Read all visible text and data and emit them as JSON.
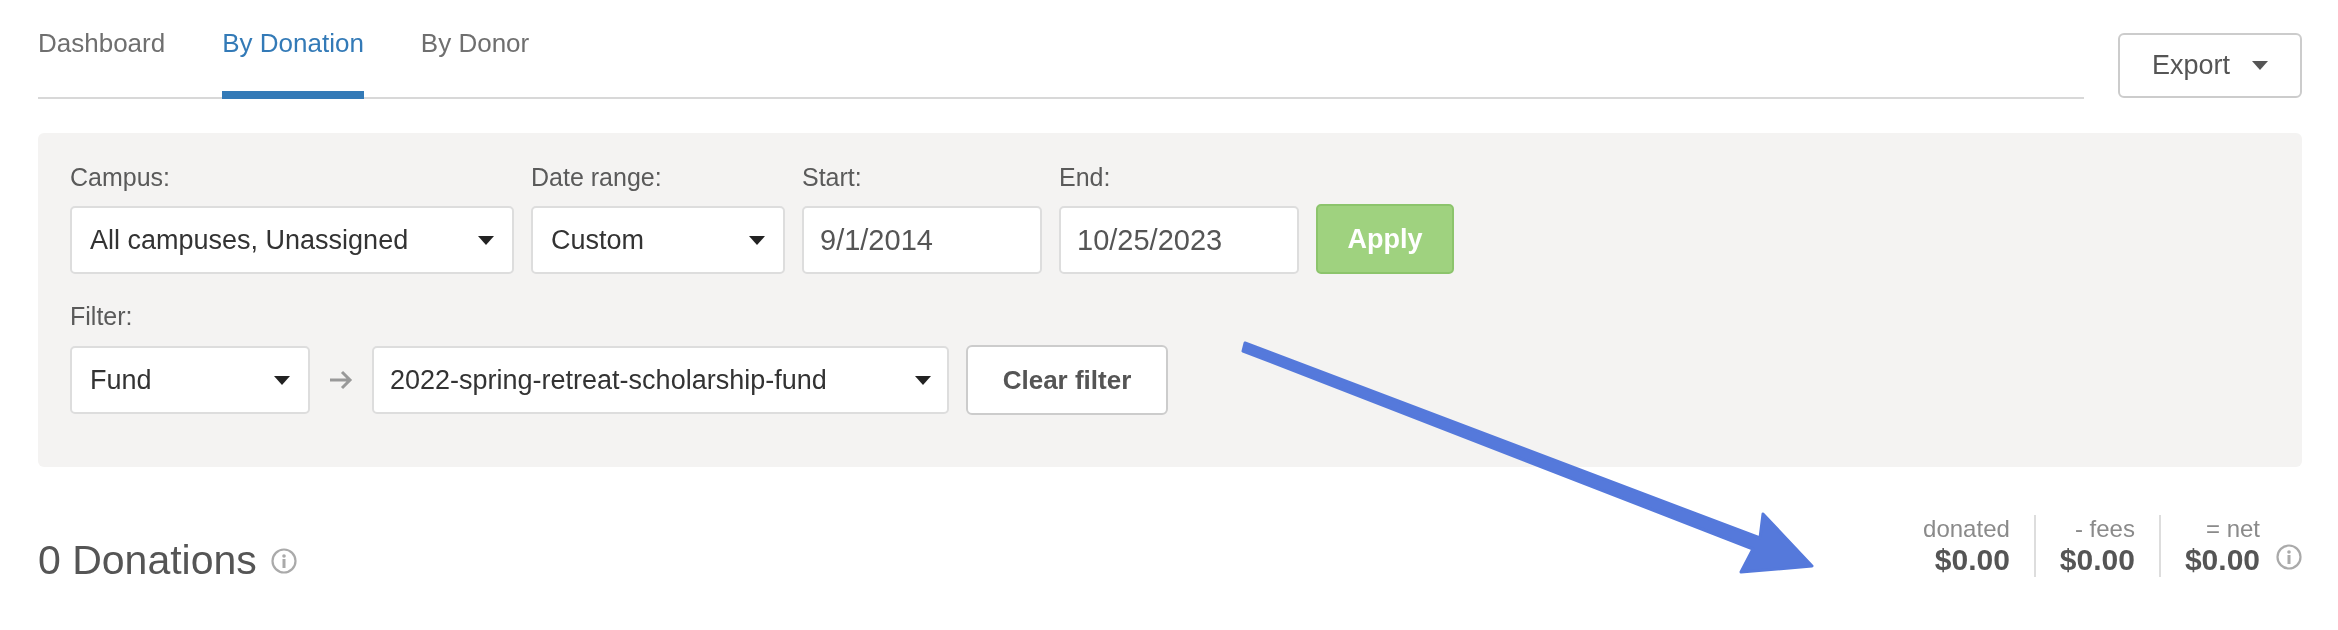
{
  "tabs": [
    {
      "label": "Dashboard",
      "selected": false
    },
    {
      "label": "By Donation",
      "selected": true
    },
    {
      "label": "By Donor",
      "selected": false
    }
  ],
  "export_button": {
    "label": "Export"
  },
  "filters": {
    "campus": {
      "label": "Campus:",
      "value": "All campuses, Unassigned"
    },
    "date_range": {
      "label": "Date range:",
      "value": "Custom"
    },
    "start": {
      "label": "Start:",
      "value": "9/1/2014"
    },
    "end": {
      "label": "End:",
      "value": "10/25/2023"
    },
    "apply_button": {
      "label": "Apply"
    },
    "filter": {
      "label": "Filter:",
      "type": "Fund",
      "value": "2022-spring-retreat-scholarship-fund"
    },
    "clear_button": {
      "label": "Clear filter"
    }
  },
  "summary": {
    "title": "0 Donations",
    "totals": [
      {
        "label": "donated",
        "amount": "$0.00"
      },
      {
        "label": "- fees",
        "amount": "$0.00"
      },
      {
        "label": "= net",
        "amount": "$0.00"
      }
    ]
  }
}
